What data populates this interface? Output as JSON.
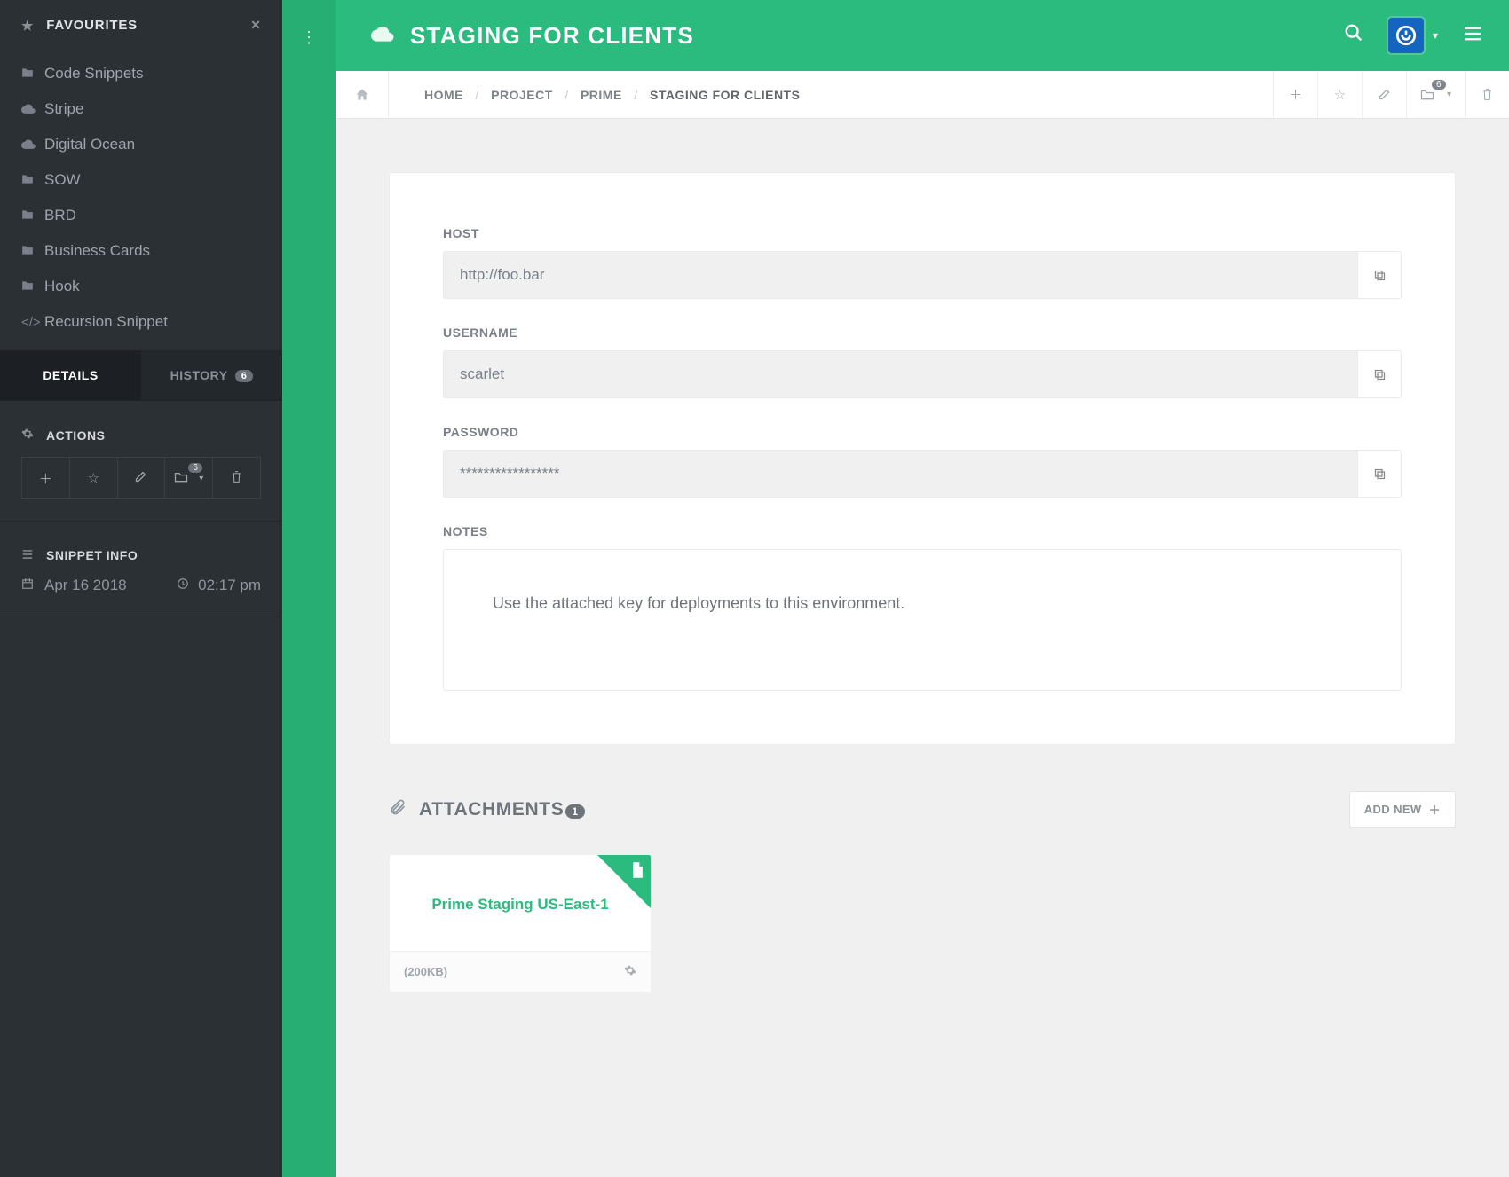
{
  "sidebar": {
    "favourites_label": "FAVOURITES",
    "items": [
      {
        "icon": "folder",
        "label": "Code Snippets"
      },
      {
        "icon": "cloud",
        "label": "Stripe"
      },
      {
        "icon": "cloud",
        "label": "Digital Ocean"
      },
      {
        "icon": "folder",
        "label": "SOW"
      },
      {
        "icon": "folder",
        "label": "BRD"
      },
      {
        "icon": "folder",
        "label": "Business Cards"
      },
      {
        "icon": "folder",
        "label": "Hook"
      },
      {
        "icon": "code",
        "label": "Recursion Snippet"
      }
    ],
    "tabs": {
      "details": "DETAILS",
      "history": "HISTORY",
      "history_count": "6"
    },
    "actions_label": "ACTIONS",
    "actions_folder_badge": "6",
    "info_label": "SNIPPET INFO",
    "info_date": "Apr 16 2018",
    "info_time": "02:17 pm"
  },
  "header": {
    "title": "STAGING FOR CLIENTS"
  },
  "breadcrumb": {
    "home": "HOME",
    "project": "PROJECT",
    "prime": "PRIME",
    "current": "STAGING FOR CLIENTS",
    "folder_badge": "6"
  },
  "fields": {
    "host_label": "HOST",
    "host_value": "http://foo.bar",
    "username_label": "USERNAME",
    "username_value": "scarlet",
    "password_label": "PASSWORD",
    "password_value": "*****************",
    "notes_label": "NOTES",
    "notes_value": "Use the attached key for deployments to this environment."
  },
  "attachments": {
    "section_label": "ATTACHMENTS",
    "count": "1",
    "addnew_label": "ADD NEW",
    "card_title": "Prime Staging US-East-1",
    "card_size": "(200KB)"
  }
}
